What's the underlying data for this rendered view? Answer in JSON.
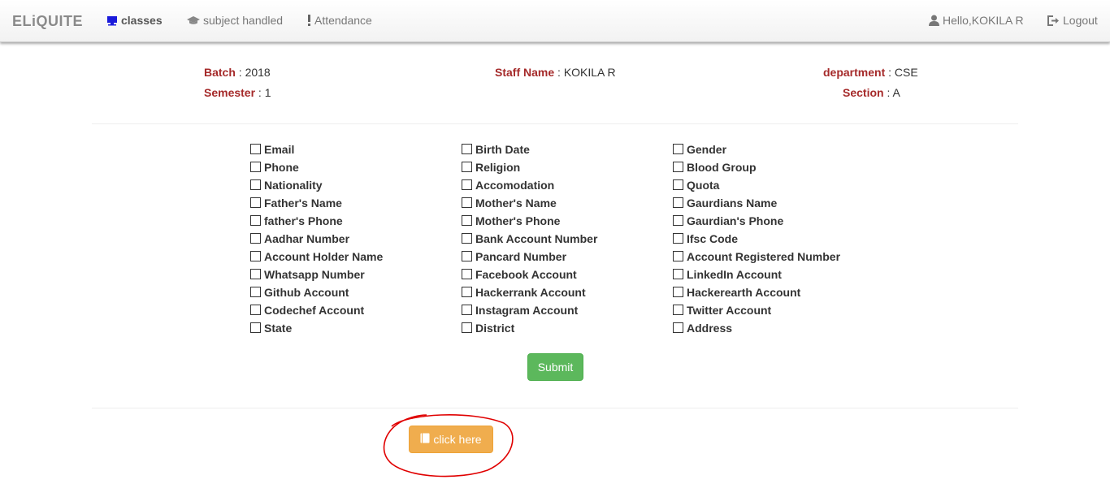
{
  "navbar": {
    "brand": "ELiQUITE",
    "items": [
      {
        "label": "classes",
        "icon": "monitor-icon",
        "active": true
      },
      {
        "label": "subject handled",
        "icon": "graduation-cap-icon",
        "active": false
      },
      {
        "label": "Attendance",
        "icon": "exclamation-icon",
        "active": false
      }
    ],
    "user": {
      "label": "Hello,KOKILA R",
      "icon": "user-icon"
    },
    "logout": {
      "label": "Logout",
      "icon": "logout-icon"
    }
  },
  "info": {
    "batch": {
      "label": "Batch",
      "sep": " : ",
      "value": "2018"
    },
    "semester": {
      "label": "Semester",
      "sep": " : ",
      "value": "1"
    },
    "staff": {
      "label": "Staff Name",
      "sep": " : ",
      "value": "KOKILA R"
    },
    "department": {
      "label": "department",
      "sep": " : ",
      "value": "CSE"
    },
    "section": {
      "label": "Section",
      "sep": " : ",
      "value": "A"
    }
  },
  "fields": {
    "col1": [
      "Email",
      "Phone",
      "Nationality",
      "Father's Name",
      "father's Phone",
      "Aadhar Number",
      "Account Holder Name",
      "Whatsapp Number",
      "Github Account",
      "Codechef Account",
      "State"
    ],
    "col2": [
      "Birth Date",
      "Religion",
      "Accomodation",
      "Mother's Name",
      "Mother's Phone",
      "Bank Account Number",
      "Pancard Number",
      "Facebook Account",
      "Hackerrank Account",
      "Instagram Account",
      "District"
    ],
    "col3": [
      "Gender",
      "Blood Group",
      "Quota",
      "Gaurdians Name",
      "Gaurdian's Phone",
      "Ifsc Code",
      "Account Registered Number",
      "LinkedIn Account",
      "Hackerearth Account",
      "Twitter Account",
      "Address"
    ]
  },
  "buttons": {
    "submit": "Submit",
    "click_here": "click here",
    "click_here_icon": "book-icon"
  },
  "colors": {
    "label": "#a52a2a",
    "submit": "#5cb85c",
    "click_here": "#f0ad4e",
    "annotation": "#e00000"
  }
}
